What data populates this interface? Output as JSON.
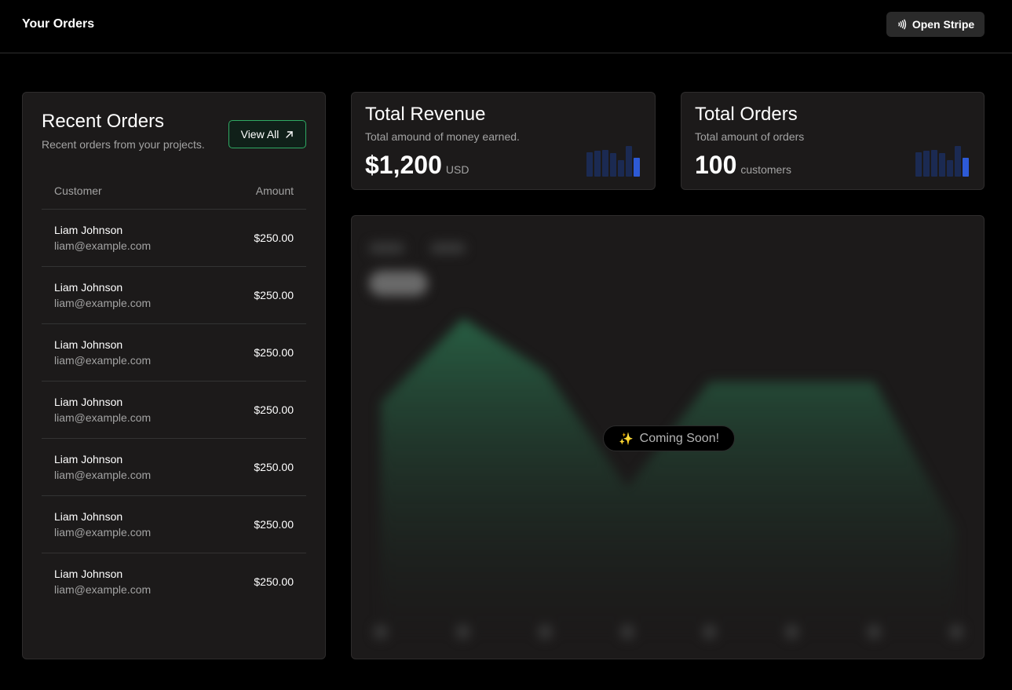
{
  "header": {
    "title": "Your Orders",
    "stripe_button": {
      "label": "Open Stripe",
      "icon": "contactless-icon"
    }
  },
  "recent_orders": {
    "title": "Recent Orders",
    "subtitle": "Recent orders from your projects.",
    "view_all_label": "View All",
    "view_all_icon": "arrow-up-right-icon",
    "columns": {
      "customer": "Customer",
      "amount": "Amount"
    },
    "rows": [
      {
        "name": "Liam Johnson",
        "email": "liam@example.com",
        "amount": "$250.00"
      },
      {
        "name": "Liam Johnson",
        "email": "liam@example.com",
        "amount": "$250.00"
      },
      {
        "name": "Liam Johnson",
        "email": "liam@example.com",
        "amount": "$250.00"
      },
      {
        "name": "Liam Johnson",
        "email": "liam@example.com",
        "amount": "$250.00"
      },
      {
        "name": "Liam Johnson",
        "email": "liam@example.com",
        "amount": "$250.00"
      },
      {
        "name": "Liam Johnson",
        "email": "liam@example.com",
        "amount": "$250.00"
      },
      {
        "name": "Liam Johnson",
        "email": "liam@example.com",
        "amount": "$250.00"
      }
    ]
  },
  "stats": {
    "revenue": {
      "title": "Total Revenue",
      "subtitle": "Total amound of money earned.",
      "value": "$1,200",
      "unit": "USD"
    },
    "orders": {
      "title": "Total Orders",
      "subtitle": "Total amount of orders",
      "value": "100",
      "unit": "customers"
    },
    "sparkline_relative_heights": [
      0.78,
      0.82,
      0.85,
      0.75,
      0.52,
      0.98,
      0.6
    ],
    "colors": {
      "bar": "#1b2a52",
      "bar_highlight": "#2d5ad6"
    }
  },
  "placeholder_chart": {
    "badge_label": "Coming Soon!",
    "badge_icon": "sparkles-icon",
    "area_relative_values": [
      0.6,
      1.0,
      0.75,
      0.2,
      0.7,
      0.7,
      0.7,
      0.0
    ],
    "colors": {
      "fill": "#2a6a4a",
      "background": "#1c1a1a"
    }
  }
}
